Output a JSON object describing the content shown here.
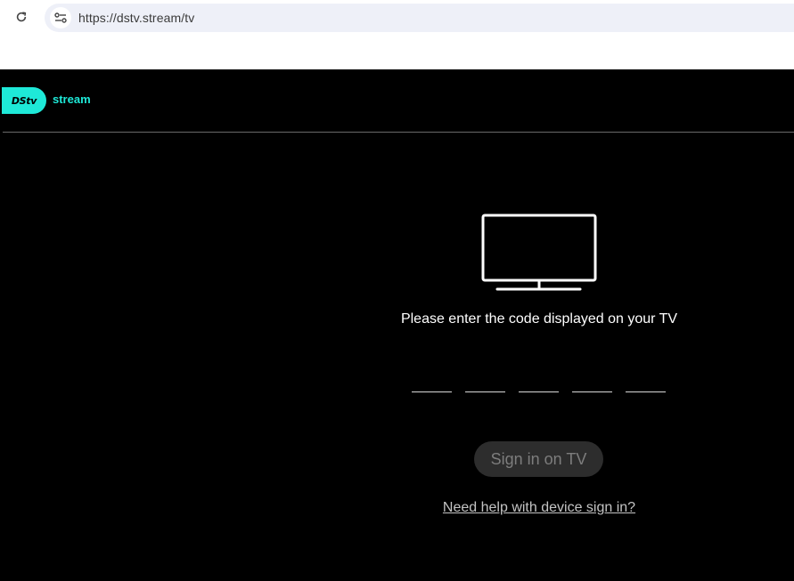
{
  "browser": {
    "url": "https://dstv.stream/tv",
    "reload_icon": "reload-icon",
    "site_info_icon": "tune-icon"
  },
  "header": {
    "logo_text": "DStv",
    "logo_suffix": "stream",
    "brand_color": "#1ee9d8"
  },
  "main": {
    "tv_icon": "tv-icon",
    "prompt": "Please enter the code displayed on your TV",
    "code_inputs": [
      "",
      "",
      "",
      "",
      ""
    ],
    "signin_label": "Sign in on TV",
    "help_link": "Need help with device sign in?"
  }
}
